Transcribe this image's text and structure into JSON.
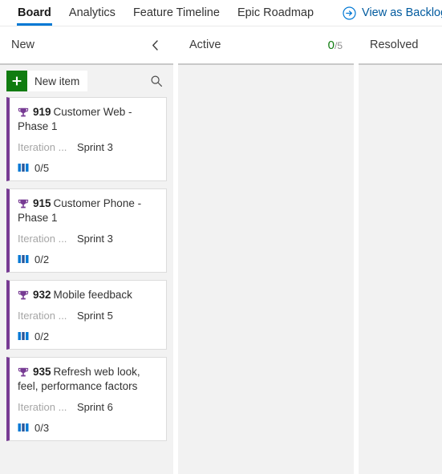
{
  "navbar": {
    "tabs": [
      {
        "label": "Board",
        "active": true
      },
      {
        "label": "Analytics",
        "active": false
      },
      {
        "label": "Feature Timeline",
        "active": false
      },
      {
        "label": "Epic Roadmap",
        "active": false
      }
    ],
    "action": {
      "label": "View as Backlog",
      "icon": "arrow-circle-right-icon",
      "color": "#005a9e"
    }
  },
  "board": {
    "columns": [
      {
        "title": "New",
        "has_collapse": true,
        "collapse_icon": "chevron-left-icon",
        "wip": null
      },
      {
        "title": "Active",
        "has_collapse": false,
        "wip": {
          "current": "0",
          "separator": "/",
          "limit": "5",
          "current_color": "#107c10"
        }
      },
      {
        "title": "Resolved",
        "has_collapse": false,
        "wip": null
      }
    ],
    "toolbar": {
      "new_item_label": "New item",
      "new_item_icon": "plus-icon",
      "new_item_color": "#107c10",
      "search_icon": "search-icon"
    },
    "cards": [
      {
        "type_icon": "trophy-icon",
        "type_color": "#773b93",
        "id": "919",
        "title": "Customer Web - Phase 1",
        "field_label": "Iteration ...",
        "field_value": "Sprint 3",
        "progress_icon": "progress-bars-icon",
        "progress_text": "0/5"
      },
      {
        "type_icon": "trophy-icon",
        "type_color": "#773b93",
        "id": "915",
        "title": "Customer Phone - Phase 1",
        "field_label": "Iteration ...",
        "field_value": "Sprint 3",
        "progress_icon": "progress-bars-icon",
        "progress_text": "0/2"
      },
      {
        "type_icon": "trophy-icon",
        "type_color": "#773b93",
        "id": "932",
        "title": "Mobile feedback",
        "field_label": "Iteration ...",
        "field_value": "Sprint 5",
        "progress_icon": "progress-bars-icon",
        "progress_text": "0/2"
      },
      {
        "type_icon": "trophy-icon",
        "type_color": "#773b93",
        "id": "935",
        "title": "Refresh web look, feel, performance factors",
        "field_label": "Iteration ...",
        "field_value": "Sprint 6",
        "progress_icon": "progress-bars-icon",
        "progress_text": "0/3"
      }
    ]
  }
}
